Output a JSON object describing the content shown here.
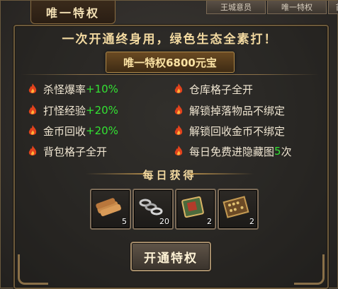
{
  "tabs": {
    "main": "唯一特权",
    "side_a": "王城意员",
    "side_b": "唯一特权",
    "side_c": "首"
  },
  "slogan": "一次开通终身用，绿色生态全素打！",
  "banner": "唯一特权6800元宝",
  "perks_left": [
    {
      "text": "杀怪爆率",
      "bonus": "+10%"
    },
    {
      "text": "打怪经验",
      "bonus": "+20%"
    },
    {
      "text": "金币回收",
      "bonus": "+20%"
    },
    {
      "text": "背包格子全开",
      "bonus": ""
    }
  ],
  "perks_right": [
    {
      "text": "仓库格子全开",
      "bonus": "",
      "tail": ""
    },
    {
      "text": "解锁掉落物品不绑定",
      "bonus": "",
      "tail": ""
    },
    {
      "text": "解锁回收金币不绑定",
      "bonus": "",
      "tail": ""
    },
    {
      "text": "每日免费进隐藏图",
      "bonus": "5",
      "tail": "次"
    }
  ],
  "daily": {
    "title": "每日获得",
    "items": [
      {
        "icon": "scroll-bundle-icon",
        "qty": "5"
      },
      {
        "icon": "chain-icon",
        "qty": "20"
      },
      {
        "icon": "green-book-icon",
        "qty": "2"
      },
      {
        "icon": "abacus-icon",
        "qty": "2"
      }
    ]
  },
  "activate_button": "开通特权",
  "colors": {
    "bonus_green": "#33e233",
    "gold_text": "#f2d9a0"
  }
}
